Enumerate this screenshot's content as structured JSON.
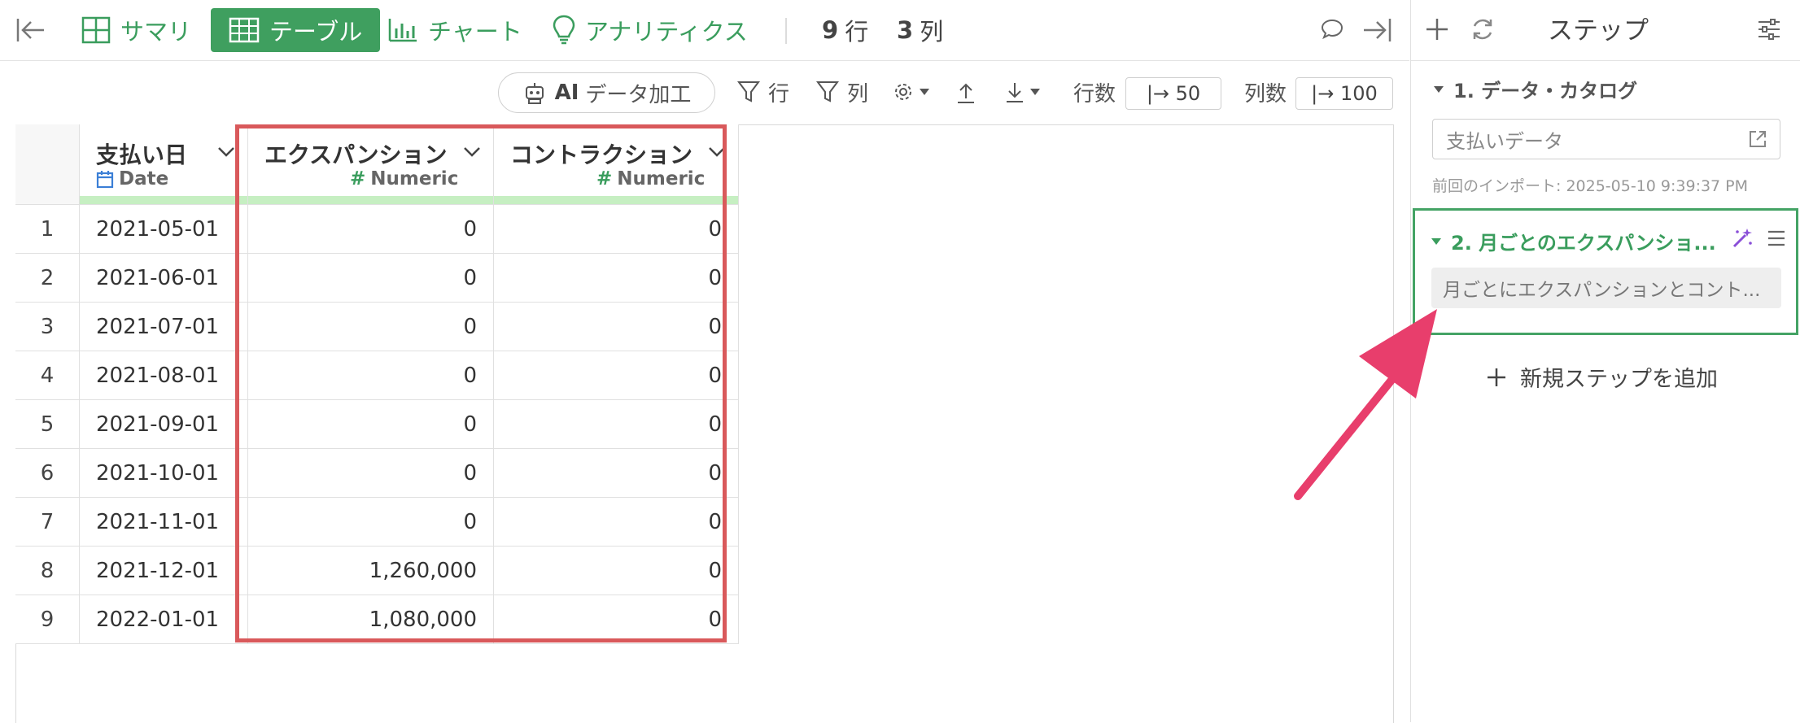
{
  "toolbar": {
    "summary_label": "サマリ",
    "table_label": "テーブル",
    "chart_label": "チャート",
    "analytics_label": "アナリティクス",
    "rows_num": "9",
    "rows_unit": "行",
    "cols_num": "3",
    "cols_unit": "列"
  },
  "toolbar2": {
    "ai_label_ai": "AI",
    "ai_label_rest": "データ加工",
    "row_filter_label": "行",
    "col_filter_label": "列",
    "rows_label": "行数",
    "rows_value": "|→ 50",
    "cols_label": "列数",
    "cols_value": "|→ 100"
  },
  "table": {
    "columns": [
      {
        "name": "支払い日",
        "type": "Date"
      },
      {
        "name": "エクスパンション",
        "type": "Numeric"
      },
      {
        "name": "コントラクション",
        "type": "Numeric"
      }
    ],
    "rows": [
      {
        "idx": "1",
        "date": "2021-05-01",
        "expansion": "0",
        "contraction": "0"
      },
      {
        "idx": "2",
        "date": "2021-06-01",
        "expansion": "0",
        "contraction": "0"
      },
      {
        "idx": "3",
        "date": "2021-07-01",
        "expansion": "0",
        "contraction": "0"
      },
      {
        "idx": "4",
        "date": "2021-08-01",
        "expansion": "0",
        "contraction": "0"
      },
      {
        "idx": "5",
        "date": "2021-09-01",
        "expansion": "0",
        "contraction": "0"
      },
      {
        "idx": "6",
        "date": "2021-10-01",
        "expansion": "0",
        "contraction": "0"
      },
      {
        "idx": "7",
        "date": "2021-11-01",
        "expansion": "0",
        "contraction": "0"
      },
      {
        "idx": "8",
        "date": "2021-12-01",
        "expansion": "1,260,000",
        "contraction": "0"
      },
      {
        "idx": "9",
        "date": "2022-01-01",
        "expansion": "1,080,000",
        "contraction": "0"
      }
    ]
  },
  "steps": {
    "title": "ステップ",
    "step1_title": "1. データ・カタログ",
    "step1_source": "支払いデータ",
    "step1_import": "前回のインポート: 2025-05-10 9:39:37 PM",
    "step2_title": "2. 月ごとのエクスパンショ...",
    "step2_desc": "月ごとにエクスパンションとコント...",
    "add_step_label": "新規ステップを追加"
  },
  "colors": {
    "accent": "#3f9f5f",
    "highlight_box": "#d9595b",
    "arrow": "#e83e6c",
    "type_bar": "#c6efc2"
  }
}
